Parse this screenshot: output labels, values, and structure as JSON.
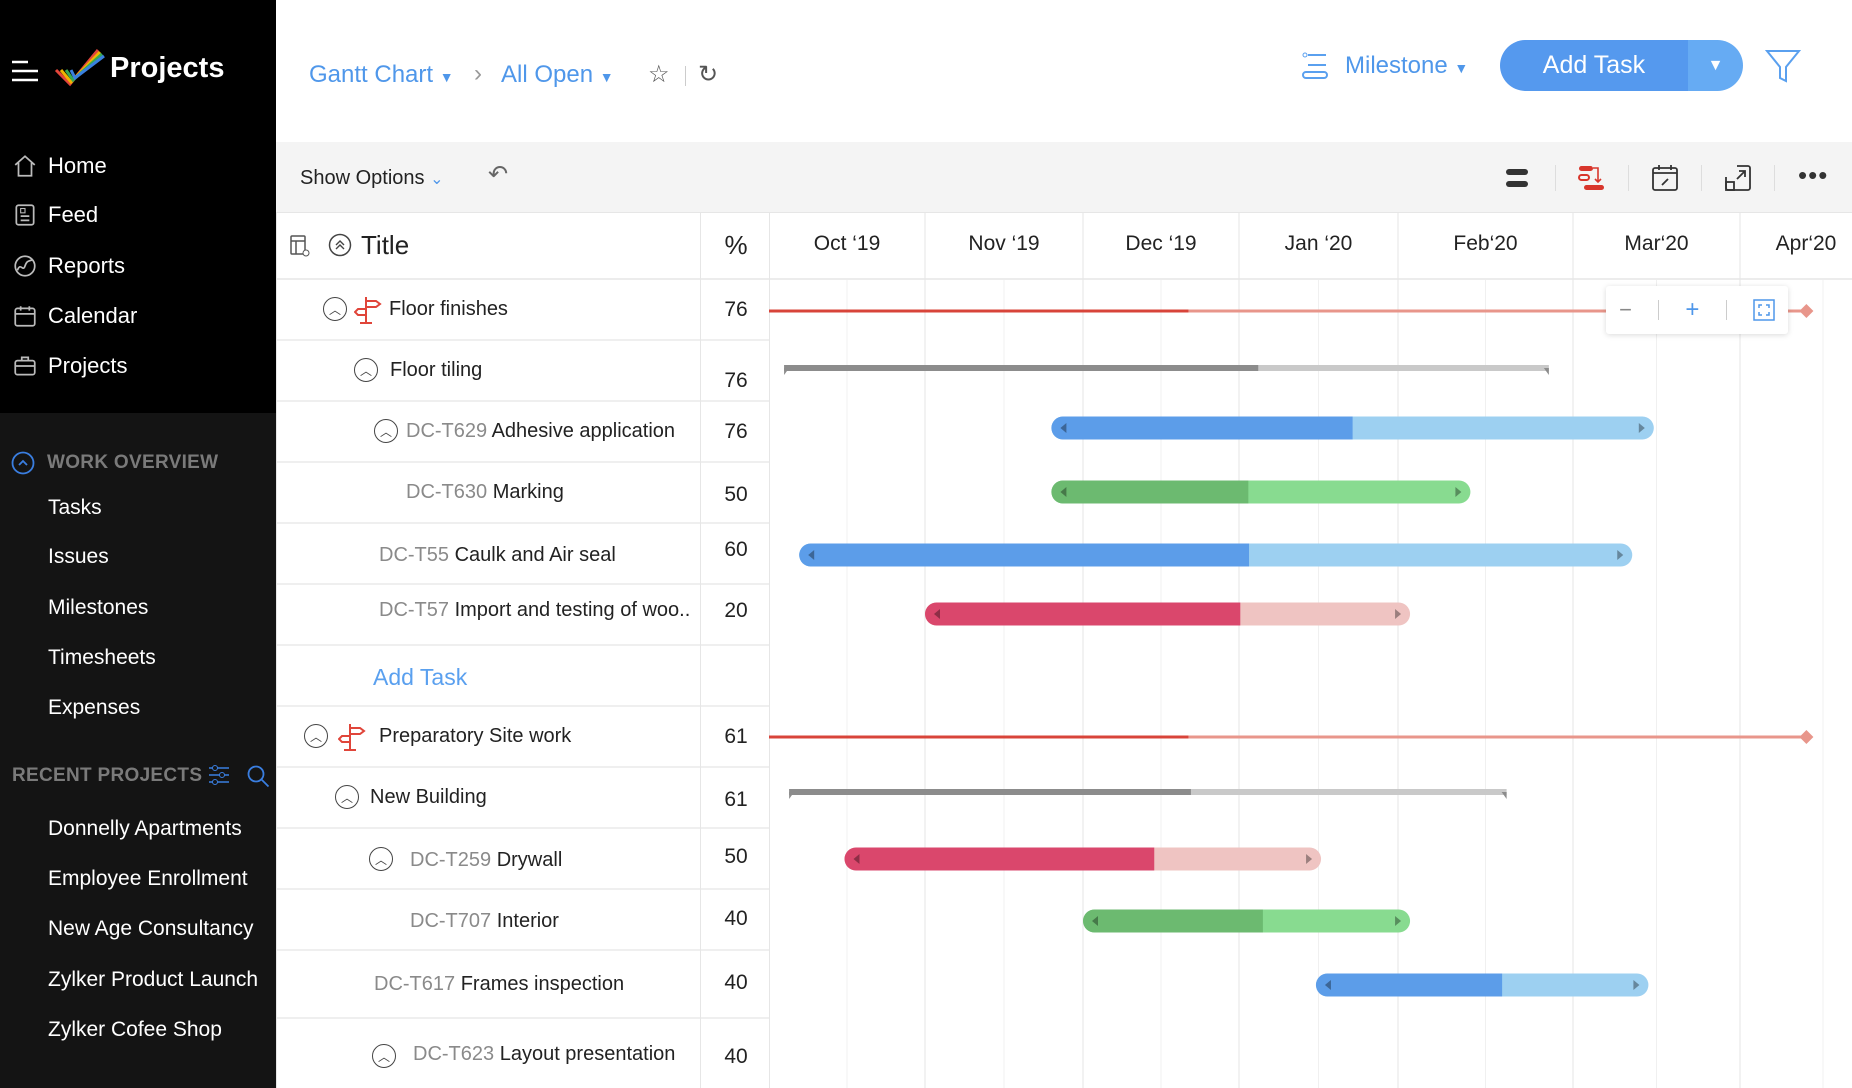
{
  "app": {
    "title": "Projects"
  },
  "sidebar": {
    "nav": [
      {
        "label": "Home",
        "icon": "home-icon"
      },
      {
        "label": "Feed",
        "icon": "feed-icon"
      },
      {
        "label": "Reports",
        "icon": "reports-icon"
      },
      {
        "label": "Calendar",
        "icon": "calendar-icon"
      },
      {
        "label": "Projects",
        "icon": "briefcase-icon"
      }
    ],
    "work_overview": {
      "title": "WORK OVERVIEW",
      "items": [
        "Tasks",
        "Issues",
        "Milestones",
        "Timesheets",
        "Expenses"
      ]
    },
    "recent_projects": {
      "title": "RECENT PROJECTS",
      "items": [
        "Donnelly Apartments",
        "Employee Enrollment",
        "New Age Consultancy",
        "Zylker Product Launch",
        "Zylker Cofee Shop"
      ]
    }
  },
  "header": {
    "view": "Gantt Chart",
    "filter": "All Open",
    "group_by": "Milestone",
    "add_task": "Add Task"
  },
  "toolbar": {
    "show_options": "Show Options"
  },
  "table": {
    "col_title": "Title",
    "col_pct": "%"
  },
  "timeline": {
    "months": [
      "Oct ‘19",
      "Nov ‘19",
      "Dec ‘19",
      "Jan ‘20",
      "Feb‘20",
      "Mar‘20",
      "Apr‘20"
    ]
  },
  "rows": [
    {
      "type": "milestone",
      "title": "Floor finishes",
      "pct": "76"
    },
    {
      "type": "tasklist",
      "title": "Floor tiling",
      "pct": "76"
    },
    {
      "type": "task",
      "id": "DC-T629",
      "title": "Adhesive application",
      "pct": "76"
    },
    {
      "type": "task",
      "id": "DC-T630",
      "title": "Marking",
      "pct": "50"
    },
    {
      "type": "task",
      "id": "DC-T55",
      "title": "Caulk and Air seal",
      "pct": "60"
    },
    {
      "type": "task",
      "id": "DC-T57",
      "title": "Import and testing of woo..",
      "pct": "20"
    },
    {
      "type": "add",
      "title": "Add Task"
    },
    {
      "type": "milestone",
      "title": "Preparatory Site work",
      "pct": "61"
    },
    {
      "type": "tasklist",
      "title": "New Building",
      "pct": "61"
    },
    {
      "type": "task",
      "id": "DC-T259",
      "title": "Drywall",
      "pct": "50"
    },
    {
      "type": "task",
      "id": "DC-T707",
      "title": "Interior",
      "pct": "40"
    },
    {
      "type": "task",
      "id": "DC-T617",
      "title": "Frames inspection",
      "pct": "40"
    },
    {
      "type": "task",
      "id": "DC-T623",
      "title": "Layout presentation",
      "pct": "40"
    }
  ],
  "chart_data": {
    "type": "gantt",
    "x_axis": {
      "range": [
        "2019-10-01",
        "2020-04-30"
      ],
      "ticks": [
        "Oct ‘19",
        "Nov ‘19",
        "Dec ‘19",
        "Jan ‘20",
        "Feb‘20",
        "Mar‘20",
        "Apr‘20"
      ]
    },
    "colors": {
      "blue": [
        "#5c9de9",
        "#9dd0f1"
      ],
      "green": [
        "#6cba70",
        "#88db90"
      ],
      "red": [
        "#da476c",
        "#efc4c2"
      ],
      "grey": [
        "#8c8c8c",
        "#c9c9c9"
      ],
      "milestone": [
        "#d8443a",
        "#e8968b"
      ]
    },
    "bars": [
      {
        "row": 0,
        "kind": "milestone",
        "start": "2019-10-01",
        "split": "2019-12-22",
        "end": "2020-04-13"
      },
      {
        "row": 1,
        "kind": "summary",
        "color": "grey",
        "start": "2019-10-04",
        "end": "2020-02-26",
        "fill": 0.62
      },
      {
        "row": 2,
        "kind": "task",
        "color": "blue",
        "start": "2019-11-25",
        "end": "2020-03-16",
        "fill": 0.5
      },
      {
        "row": 3,
        "kind": "task",
        "color": "green",
        "start": "2019-11-25",
        "end": "2020-02-13",
        "fill": 0.47
      },
      {
        "row": 4,
        "kind": "task",
        "color": "blue",
        "start": "2019-10-07",
        "end": "2020-03-12",
        "fill": 0.54
      },
      {
        "row": 5,
        "kind": "task",
        "color": "red",
        "start": "2019-11-01",
        "end": "2020-02-03",
        "fill": 0.65
      },
      {
        "row": 7,
        "kind": "milestone",
        "start": "2019-10-01",
        "split": "2019-12-22",
        "end": "2020-04-13"
      },
      {
        "row": 8,
        "kind": "summary",
        "color": "grey",
        "start": "2019-10-05",
        "end": "2020-02-19",
        "fill": 0.56
      },
      {
        "row": 9,
        "kind": "task",
        "color": "red",
        "start": "2019-10-16",
        "end": "2020-01-17",
        "fill": 0.65
      },
      {
        "row": 10,
        "kind": "task",
        "color": "green",
        "start": "2019-12-01",
        "end": "2020-02-03",
        "fill": 0.55
      },
      {
        "row": 11,
        "kind": "task",
        "color": "blue",
        "start": "2020-01-16",
        "end": "2020-03-15",
        "fill": 0.56
      }
    ]
  }
}
